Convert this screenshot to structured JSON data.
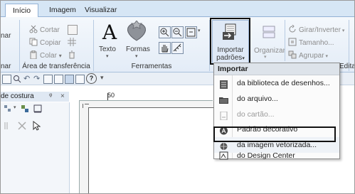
{
  "tabs": [
    {
      "label": "Início",
      "active": true
    },
    {
      "label": "Imagem",
      "active": false
    },
    {
      "label": "Visualizar",
      "active": false
    }
  ],
  "ribbon": {
    "clipboard": {
      "cut": "Cortar",
      "copy": "Copiar",
      "paste": "Colar",
      "left_fragment": "nar",
      "group_label": "Área de transferência",
      "left_group_fragment": "nar"
    },
    "tools": {
      "text": "Texto",
      "shapes": "Formas",
      "group_label": "Ferramentas"
    },
    "import": {
      "label_line1": "Importar",
      "label_line2": "padrões"
    },
    "organize": {
      "label": "Organizar"
    },
    "rotate": {
      "label": "Girar/Inverter"
    },
    "size": {
      "label": "Tamanho..."
    },
    "group": {
      "label": "Agrupar"
    },
    "edit_fragment": "Edita"
  },
  "toolbar": {
    "ruler_mark": "50"
  },
  "left_panel": {
    "title_fragment": "de costura",
    "pin_label": "ᵠ",
    "close_label": "×"
  },
  "import_menu": {
    "header": "Importar",
    "items": [
      {
        "label": "da biblioteca de desenhos...",
        "enabled": true,
        "icon": "library-icon"
      },
      {
        "label": "do arquivo...",
        "enabled": true,
        "icon": "folder-icon"
      },
      {
        "label": "do cartão...",
        "enabled": false,
        "icon": "card-icon"
      },
      {
        "label": "Padrão decorativo",
        "enabled": true,
        "icon": "decorative-pattern-icon"
      },
      {
        "label": "da imagem vetorizada...",
        "enabled": true,
        "icon": "vector-image-icon",
        "highlighted": true
      },
      {
        "label": "do Design Center",
        "enabled": true,
        "icon": "design-center-icon"
      }
    ]
  },
  "colors": {
    "ribbon_bg": "#e3ecf7",
    "tab_strip": "#d6e6f5",
    "callout": "#111111"
  }
}
